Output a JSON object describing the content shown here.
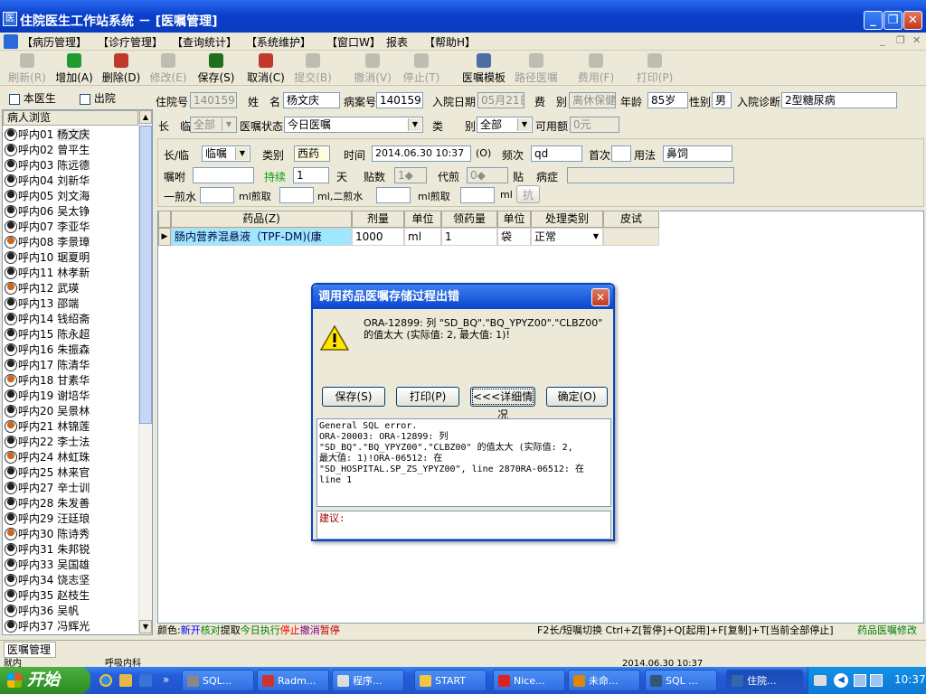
{
  "window": {
    "title": "住院医生工作站系统 － [医嘱管理]",
    "min": "_",
    "max": "❐",
    "close": "✕"
  },
  "menu": [
    "【病历管理】",
    "【诊疗管理】",
    "【查询统计】",
    "【系统维护】",
    "【窗口W】",
    "报表",
    "【帮助H】"
  ],
  "toolbar": [
    {
      "label": "刷新(R)",
      "enabled": false,
      "icon": "refresh-icon",
      "color": "#9aa"
    },
    {
      "label": "增加(A)",
      "enabled": true,
      "icon": "add-icon",
      "color": "#1f9b2e"
    },
    {
      "label": "删除(D)",
      "enabled": true,
      "icon": "delete-icon",
      "color": "#c0392b"
    },
    {
      "label": "修改(E)",
      "enabled": false,
      "icon": "edit-icon",
      "color": "#aaa"
    },
    {
      "label": "保存(S)",
      "enabled": true,
      "icon": "save-icon",
      "color": "#1d6e1f"
    },
    {
      "label": "取消(C)",
      "enabled": true,
      "icon": "undo-icon",
      "color": "#c0392b"
    },
    {
      "label": "提交(B)",
      "enabled": false,
      "icon": "submit-icon",
      "color": "#aaa"
    },
    {
      "label": "撤消(V)",
      "enabled": false,
      "icon": "revoke-icon",
      "color": "#aaa"
    },
    {
      "label": "停止(T)",
      "enabled": false,
      "icon": "stop-icon",
      "color": "#aaa"
    },
    {
      "label": "医嘱模板",
      "enabled": true,
      "icon": "template-icon",
      "color": "#4a6fa5"
    },
    {
      "label": "路径医嘱",
      "enabled": false,
      "icon": "path-icon",
      "color": "#aaa"
    },
    {
      "label": "费用(F)",
      "enabled": false,
      "icon": "fee-icon",
      "color": "#aaa"
    },
    {
      "label": "打印(P)",
      "enabled": false,
      "icon": "print-icon",
      "color": "#aaa"
    }
  ],
  "filters": {
    "doctor": "本医生",
    "discharged": "出院"
  },
  "patients": {
    "header": "病人浏览",
    "items": [
      {
        "bed": "呼内01",
        "name": "杨文庆",
        "g": "m"
      },
      {
        "bed": "呼内02",
        "name": "曾平生",
        "g": "m"
      },
      {
        "bed": "呼内03",
        "name": "陈远德",
        "g": "m"
      },
      {
        "bed": "呼内04",
        "name": "刘新华",
        "g": "m"
      },
      {
        "bed": "呼内05",
        "name": "刘文海",
        "g": "m"
      },
      {
        "bed": "呼内06",
        "name": "吴太铮",
        "g": "m"
      },
      {
        "bed": "呼内07",
        "name": "李亚华",
        "g": "m"
      },
      {
        "bed": "呼内08",
        "name": "李景璋",
        "g": "f"
      },
      {
        "bed": "呼内10",
        "name": "琚夏明",
        "g": "m"
      },
      {
        "bed": "呼内11",
        "name": "林孝新",
        "g": "m"
      },
      {
        "bed": "呼内12",
        "name": "武瑛",
        "g": "f"
      },
      {
        "bed": "呼内13",
        "name": "邵端",
        "g": "m"
      },
      {
        "bed": "呼内14",
        "name": "钱绍斋",
        "g": "m"
      },
      {
        "bed": "呼内15",
        "name": "陈永超",
        "g": "m"
      },
      {
        "bed": "呼内16",
        "name": "朱振森",
        "g": "m"
      },
      {
        "bed": "呼内17",
        "name": "陈清华",
        "g": "m"
      },
      {
        "bed": "呼内18",
        "name": "甘素华",
        "g": "f"
      },
      {
        "bed": "呼内19",
        "name": "谢培华",
        "g": "m"
      },
      {
        "bed": "呼内20",
        "name": "吴景林",
        "g": "m"
      },
      {
        "bed": "呼内21",
        "name": "林锦莲",
        "g": "f"
      },
      {
        "bed": "呼内22",
        "name": "李士法",
        "g": "m"
      },
      {
        "bed": "呼内24",
        "name": "林虹珠",
        "g": "f"
      },
      {
        "bed": "呼内25",
        "name": "林来官",
        "g": "m"
      },
      {
        "bed": "呼内27",
        "name": "辛士训",
        "g": "m"
      },
      {
        "bed": "呼内28",
        "name": "朱发善",
        "g": "m"
      },
      {
        "bed": "呼内29",
        "name": "汪廷琅",
        "g": "m"
      },
      {
        "bed": "呼内30",
        "name": "陈诗秀",
        "g": "f"
      },
      {
        "bed": "呼内31",
        "name": "朱邦锐",
        "g": "m"
      },
      {
        "bed": "呼内33",
        "name": "吴国雄",
        "g": "m"
      },
      {
        "bed": "呼内34",
        "name": "饶志坚",
        "g": "m"
      },
      {
        "bed": "呼内35",
        "name": "赵枝生",
        "g": "m"
      },
      {
        "bed": "呼内36",
        "name": "吴帆",
        "g": "m"
      },
      {
        "bed": "呼内37",
        "name": "冯辉光",
        "g": "m"
      }
    ]
  },
  "patient_info": {
    "admission_no_label": "住院号",
    "admission_no": "1401591",
    "name_label": "姓　名",
    "name": "杨文庆",
    "record_no_label": "病案号",
    "record_no": "1401591",
    "admit_date_label": "入院日期",
    "admit_date": "05月21日",
    "fee_type_label": "费　别",
    "fee_type": "离休保健",
    "age_label": "年龄",
    "age": "85岁",
    "sex_label": "性别",
    "sex": "男",
    "diagnosis_label": "入院诊断",
    "diagnosis": "2型糖尿病"
  },
  "order_filter": {
    "long_temp_label": "长　临",
    "long_temp": "全部",
    "status_label": "医嘱状态",
    "status": "今日医嘱",
    "category_label": "类　　别",
    "category": "全部",
    "balance_label": "可用额",
    "balance": "0元"
  },
  "order_edit": {
    "type_label": "长/临",
    "type": "临嘱",
    "cat_label": "类别",
    "cat": "西药",
    "time_label": "时间",
    "time": "2014.06.30 10:37",
    "time_btn": "(O)",
    "freq_label": "频次",
    "freq": "qd",
    "first_label": "首次",
    "first": "",
    "usage_label": "用法",
    "usage": "鼻饲",
    "note_label": "嘱咐",
    "note": "",
    "duration_label": "持续",
    "duration": "1",
    "day_unit": "天",
    "packs_label": "贴数",
    "packs": "1",
    "decoct_label": "代煎",
    "decoct": "0",
    "pack_unit": "贴",
    "disease_label": "病症",
    "disease": "",
    "water1_label": "一煎水",
    "ml": "ml",
    "ml_decoct_label": "ml煎取",
    "water2_label": "ml,二煎水",
    "ml_decoct2_label": "ml煎取",
    "ml_end": "ml",
    "anti_btn": "抗"
  },
  "grid": {
    "columns": [
      "药品(Z)",
      "剂量",
      "单位",
      "领药量",
      "单位",
      "处理类别",
      "皮试"
    ],
    "row": [
      "肠内营养混悬液（TPF-DM)(康",
      "1000",
      "ml",
      "1",
      "袋",
      "正常",
      ""
    ]
  },
  "dialog": {
    "title": "调用药品医嘱存储过程出错",
    "message": "ORA-12899: 列 \"SD_BQ\".\"BQ_YPYZ00\".\"CLBZ00\" 的值太大 (实际值: 2, 最大值: 1)!",
    "buttons": {
      "save": "保存(S)",
      "print": "打印(P)",
      "details": "<<<详细情况",
      "ok": "确定(O)"
    },
    "detail": "General SQL error.\nORA-20003: ORA-12899: 列\n\"SD_BQ\".\"BQ_YPYZ00\".\"CLBZ00\" 的值太大 (实际值: 2,\n最大值: 1)!ORA-06512: 在\n\"SD_HOSPITAL.SP_ZS_YPYZ00\", line 2870RA-06512: 在\nline 1",
    "suggest_label": "建议:"
  },
  "legend": {
    "prefix": "颜色:",
    "items": [
      {
        "t": "新开",
        "c": "#0000ff"
      },
      {
        "t": "核对",
        "c": "#008000"
      },
      {
        "t": "提取",
        "c": "#000000"
      },
      {
        "t": "今日执行",
        "c": "#008000"
      },
      {
        "t": "停止",
        "c": "#ff0000"
      },
      {
        "t": "撤消",
        "c": "#800080"
      },
      {
        "t": "暂停",
        "c": "#c00000"
      }
    ],
    "shortcuts": "F2长/短嘱切换 Ctrl+Z[暂停]+Q[起用]+F[复制]+T[当前全部停止]",
    "mod_label": "药品医嘱修改"
  },
  "status": {
    "tab": "医嘱管理",
    "left": "就内",
    "mid": "呼吸内科",
    "time": "2014.06.30 10:37"
  },
  "taskbar": {
    "start": "开始",
    "tasks": [
      {
        "t": "SQL...",
        "c": "#888"
      },
      {
        "t": "Radm...",
        "c": "#c33"
      },
      {
        "t": "程序...",
        "c": "#ddd"
      },
      {
        "t": "START",
        "c": "#f4c542"
      },
      {
        "t": "Nice...",
        "c": "#d22"
      },
      {
        "t": "未命...",
        "c": "#d80"
      },
      {
        "t": "SQL ...",
        "c": "#357"
      },
      {
        "t": "住院...",
        "c": "#36a"
      }
    ],
    "clock": "10:37"
  }
}
